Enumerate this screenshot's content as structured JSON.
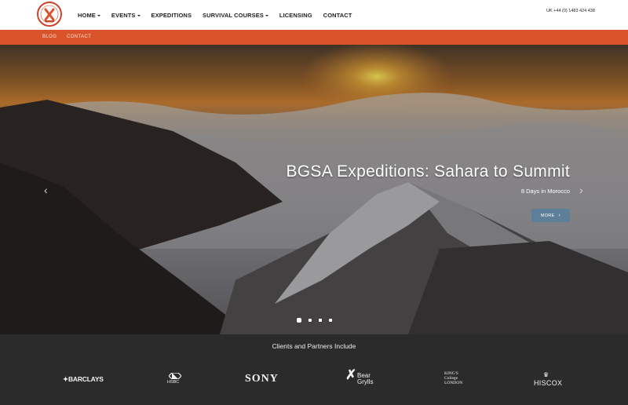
{
  "header": {
    "logo": "bear-grylls-survival-academy-logo",
    "nav": [
      {
        "label": "HOME",
        "dropdown": true
      },
      {
        "label": "EVENTS",
        "dropdown": true
      },
      {
        "label": "EXPEDITIONS",
        "dropdown": false
      },
      {
        "label": "SURVIVAL COURSES",
        "dropdown": true
      },
      {
        "label": "LICENSING",
        "dropdown": false
      },
      {
        "label": "CONTACT",
        "dropdown": false
      }
    ],
    "phone": "UK +44 (0) 1483 424 438"
  },
  "subnav": {
    "items": [
      "BLOG",
      "CONTACT"
    ]
  },
  "hero": {
    "title": "BGSA Expeditions: Sahara to Summit",
    "subtitle": "8 Days in Morocco",
    "button_label": "MORE",
    "button_icon": "chevron-right-icon",
    "prev_icon": "chevron-left-icon",
    "next_icon": "chevron-right-icon",
    "slides_count": 4,
    "active_slide": 1
  },
  "clients": {
    "title": "Clients and Partners Include",
    "logos": [
      "BARCLAYS",
      "HSBC",
      "SONY",
      "Bear Grylls",
      "King's College London",
      "HISCOX"
    ],
    "bear_lines": [
      "Bear",
      "Grylls"
    ],
    "kings_lines": [
      "KING'S",
      "College",
      "LONDON"
    ]
  },
  "colors": {
    "accent": "#d9532b",
    "logo_ring": "#c8452b",
    "button": "#5d7f99",
    "footer_bg": "#2b2b2b"
  }
}
